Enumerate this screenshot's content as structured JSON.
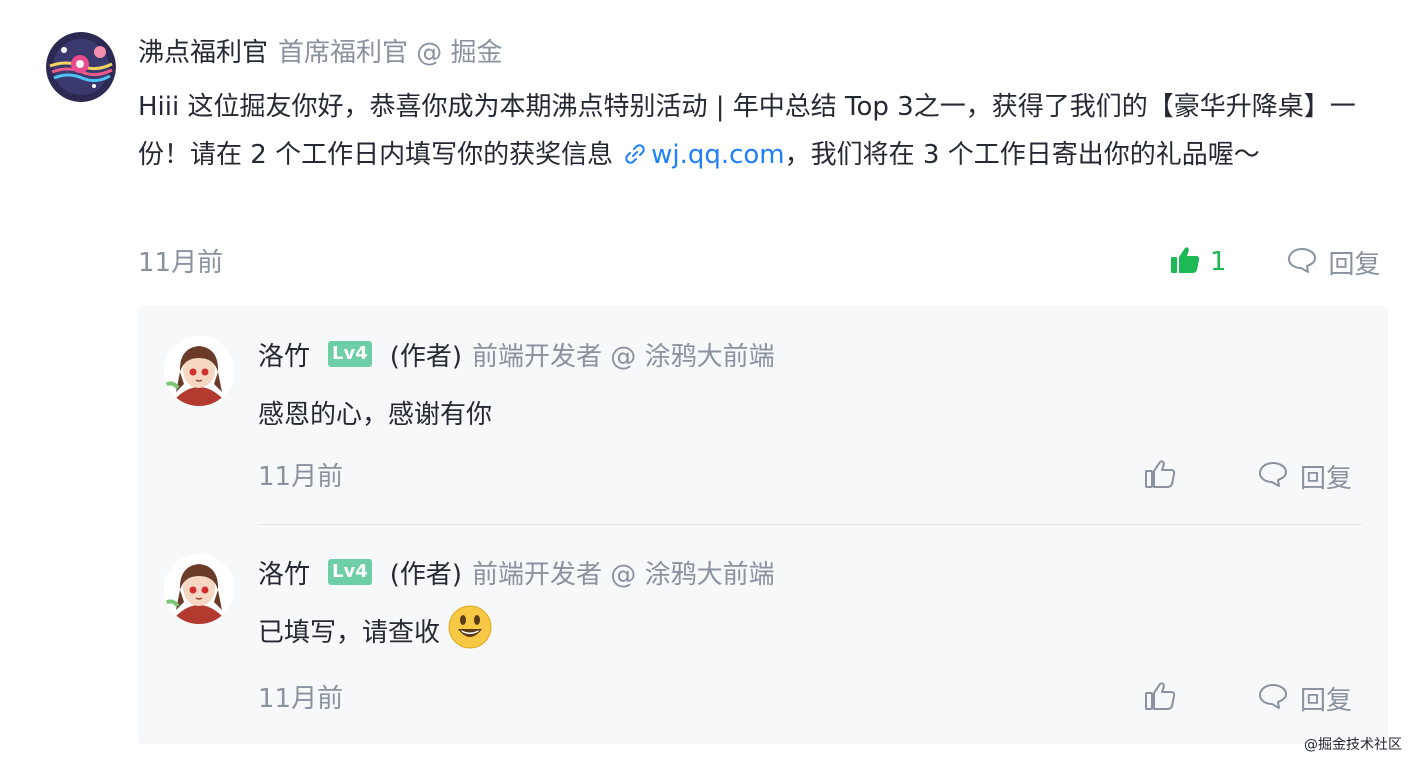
{
  "comment": {
    "author": "沸点福利官",
    "author_title": "首席福利官 @ 掘金",
    "content_before_link": "Hiii 这位掘友你好，恭喜你成为本期沸点特别活动 | 年中总结 Top 3之一，获得了我们的【豪华升降桌】一份！请在 2 个工作日内填写你的获奖信息",
    "link_text": "wj.qq.com",
    "content_after_link": "，我们将在 3 个工作日寄出你的礼品喔～",
    "time": "11月前",
    "like_count": "1",
    "reply_label": "回复"
  },
  "replies": [
    {
      "author": "洛竹",
      "level": "Lv4",
      "author_tag": "(作者)",
      "author_title": "前端开发者 @ 涂鸦大前端",
      "content": "感恩的心，感谢有你",
      "time": "11月前",
      "reply_label": "回复"
    },
    {
      "author": "洛竹",
      "level": "Lv4",
      "author_tag": "(作者)",
      "author_title": "前端开发者 @ 涂鸦大前端",
      "content": "已填写，请查收",
      "time": "11月前",
      "reply_label": "回复"
    }
  ],
  "watermark": "@掘金技术社区",
  "colors": {
    "like_active": "#1db954",
    "link": "#1e80ff",
    "muted_text": "#8a919f",
    "level_badge": "#6ecfa7",
    "reply_background": "#f7f8fa"
  },
  "icons": {
    "thumbs_up_filled": "thumbs-up-filled-icon",
    "thumbs_up_outline": "thumbs-up-outline-icon",
    "comment": "comment-bubble-icon",
    "link": "link-icon",
    "emoji": "smiley-emoji"
  }
}
